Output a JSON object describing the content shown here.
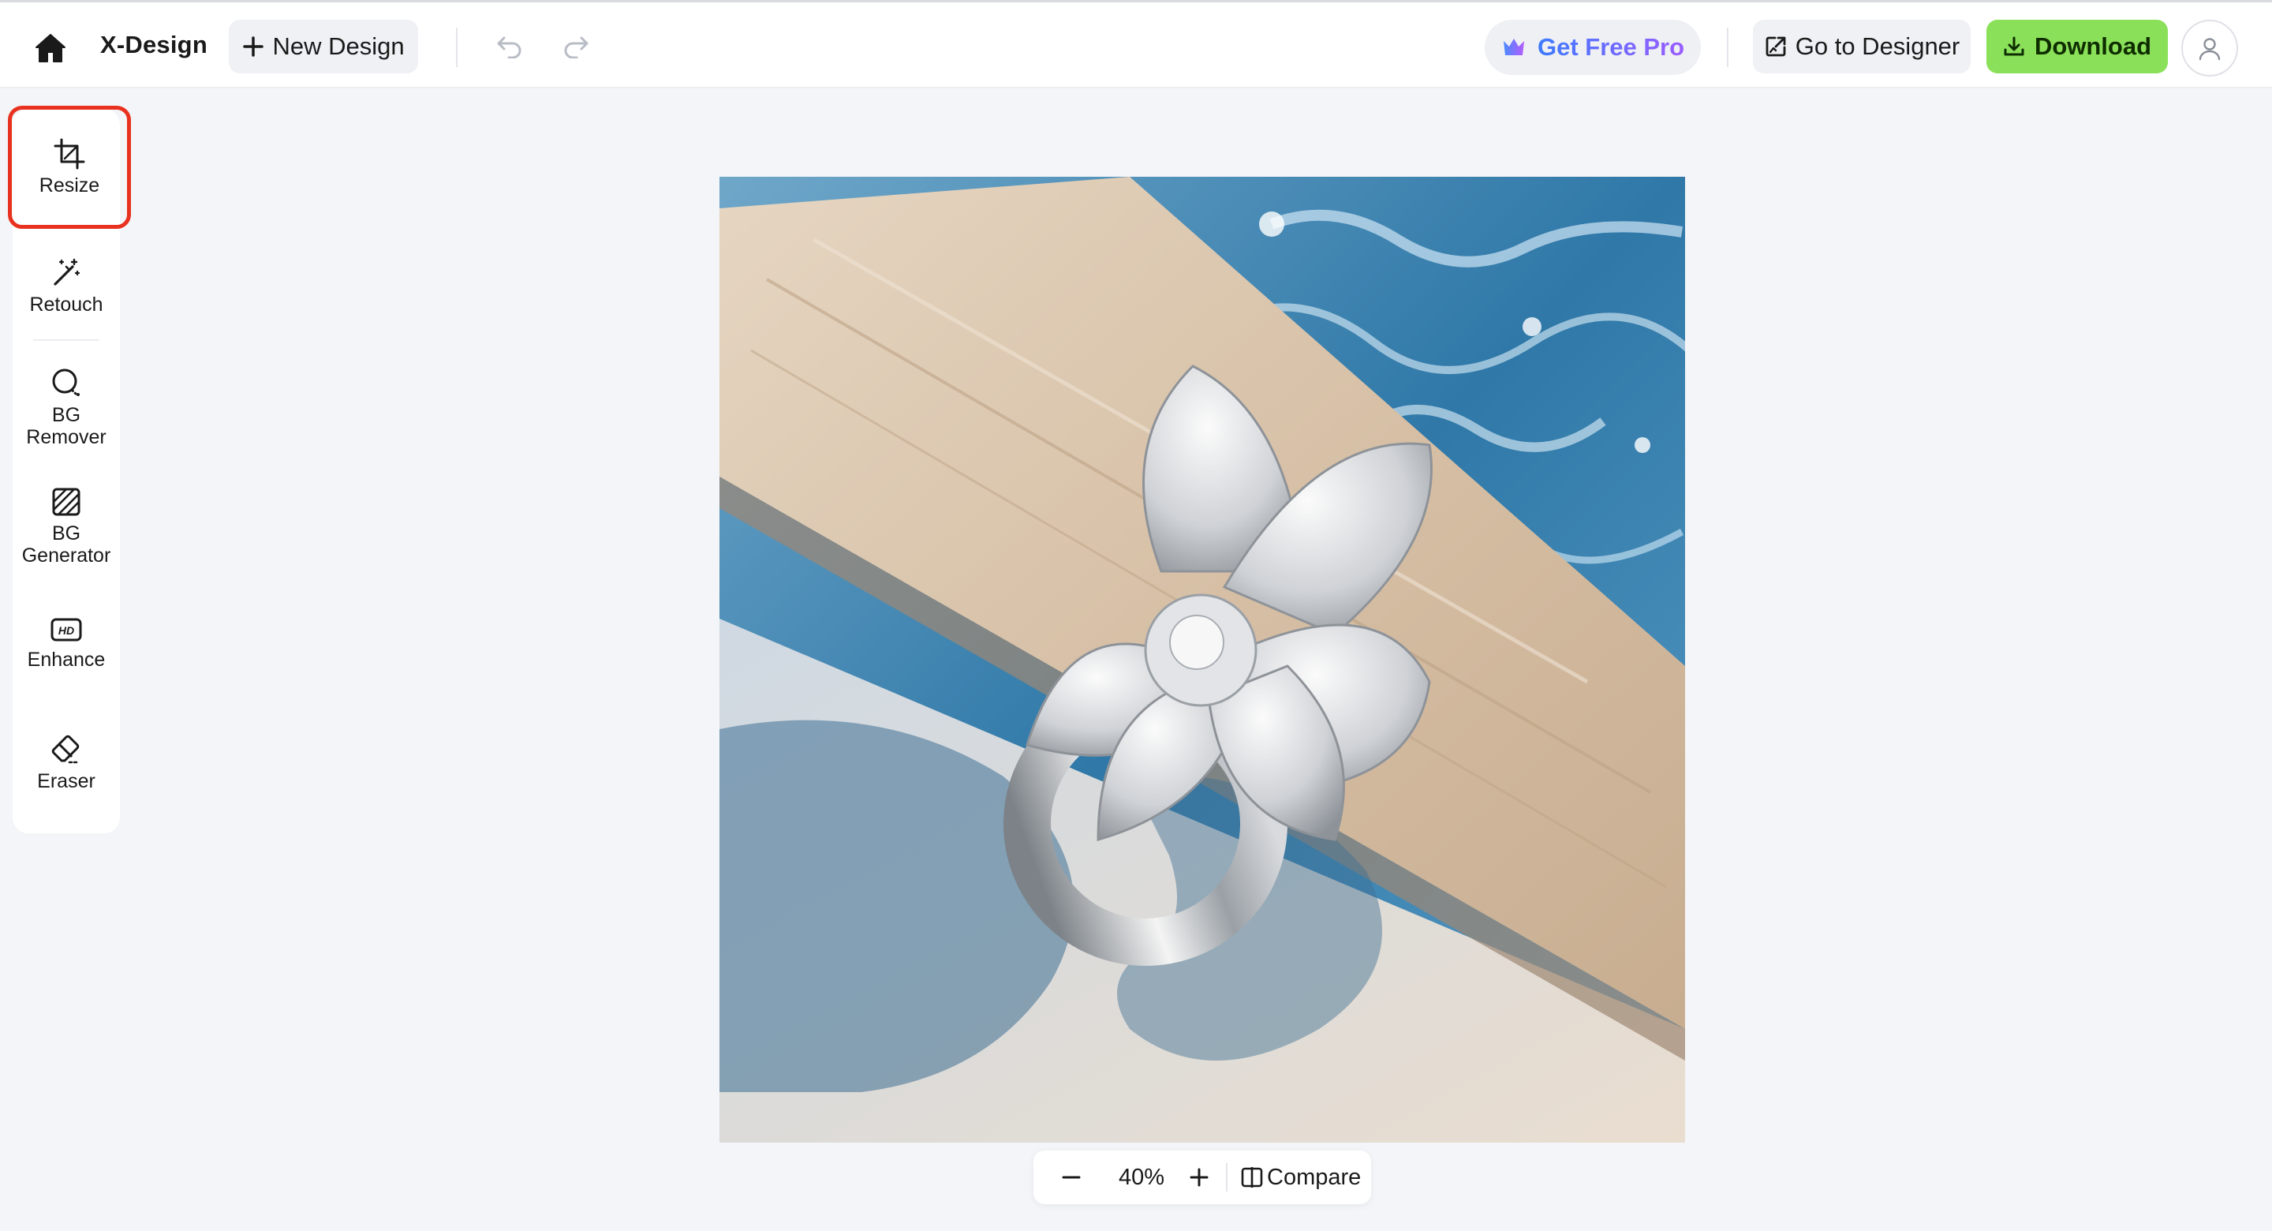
{
  "header": {
    "brand": "X-Design",
    "new_design_label": "New Design",
    "get_pro_label": "Get Free Pro",
    "go_designer_label": "Go to Designer",
    "download_label": "Download"
  },
  "sidebar": {
    "items": [
      {
        "label": "Resize",
        "icon": "crop-icon",
        "active": true
      },
      {
        "label": "Retouch",
        "icon": "magic-wand-icon"
      },
      {
        "label": "BG\nRemover",
        "icon": "bg-remover-icon"
      },
      {
        "label": "BG\nGenerator",
        "icon": "bg-generator-icon"
      },
      {
        "label": "Enhance",
        "icon": "hd-icon"
      },
      {
        "label": "Eraser",
        "icon": "eraser-icon"
      }
    ]
  },
  "zoom": {
    "value": "40%",
    "compare_label": "Compare"
  },
  "colors": {
    "accent_green": "#8be05a",
    "active_outline": "#e8321f",
    "pro_gradient_start": "#3d7bff",
    "pro_gradient_end": "#9b5cff"
  }
}
